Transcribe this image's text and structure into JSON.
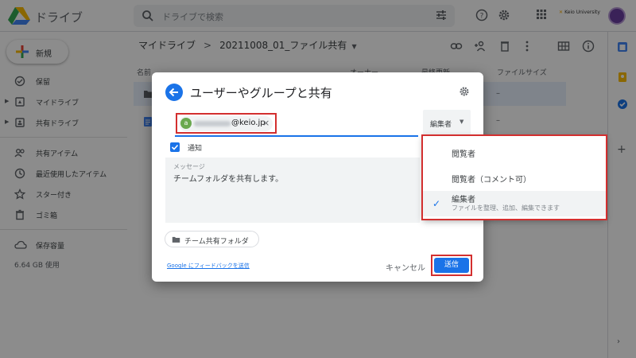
{
  "header": {
    "app_name": "ドライブ",
    "search_placeholder": "ドライブで検索",
    "org_badge": "Keio University"
  },
  "sidebar": {
    "new_label": "新規",
    "items": [
      {
        "label": "保留"
      },
      {
        "label": "マイドライブ"
      },
      {
        "label": "共有ドライブ"
      },
      {
        "label": "共有アイテム"
      },
      {
        "label": "最近使用したアイテム"
      },
      {
        "label": "スター付き"
      },
      {
        "label": "ゴミ箱"
      },
      {
        "label": "保存容量"
      }
    ],
    "storage_used": "6.64 GB 使用"
  },
  "main": {
    "breadcrumb": {
      "root": "マイドライブ",
      "folder": "20211008_01_ファイル共有"
    },
    "columns": {
      "name": "名前",
      "owner": "オーナー",
      "modified": "最終更新",
      "size": "ファイルサイズ"
    },
    "rows": [
      {
        "size": "–"
      },
      {
        "size": "–"
      }
    ]
  },
  "dialog": {
    "title": "ユーザーやグループと共有",
    "recipient": {
      "avatar_letter": "a",
      "email_domain": "@keio.jp"
    },
    "role_selected": "編集者",
    "notify_label": "通知",
    "message": {
      "caption": "メッセージ",
      "text": "チームフォルダを共有します。"
    },
    "team_folder": "チーム共有フォルダ",
    "feedback_link": "Google にフィードバックを送信",
    "cancel_label": "キャンセル",
    "send_label": "送信"
  },
  "role_menu": {
    "options": [
      {
        "label": "閲覧者"
      },
      {
        "label": "閲覧者（コメント可）"
      },
      {
        "label": "編集者",
        "sub": "ファイルを整理、追加、編集できます",
        "selected": true
      }
    ]
  },
  "colors": {
    "accent": "#1a73e8",
    "highlight_border": "#d32f2f"
  },
  "icons": [
    "drive-logo",
    "search-icon",
    "tune-icon",
    "help-icon",
    "settings-icon",
    "apps-icon",
    "link-icon",
    "add-person-icon",
    "trash-icon",
    "more-icon",
    "grid-icon",
    "info-icon",
    "back-arrow-icon",
    "check-icon",
    "folder-icon",
    "close-icon"
  ]
}
